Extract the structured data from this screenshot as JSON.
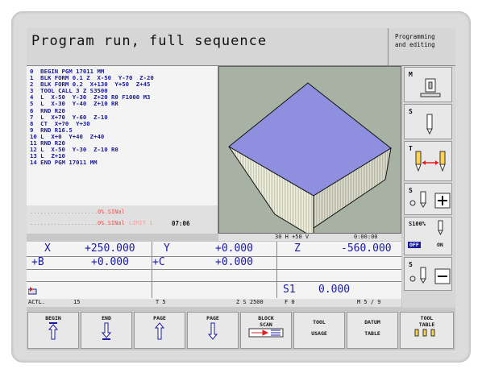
{
  "header": {
    "title": "Program run, full sequence",
    "mode_line1": "Programming",
    "mode_line2": "and editing"
  },
  "program": {
    "lines": [
      "0  BEGIN PGM 17011 MM",
      "1  BLK FORM 0.1 Z  X-50  Y-70  Z-20",
      "2  BLK FORM 0.2  X+130  Y+50  Z+45",
      "3  TOOL CALL 3 Z S3500",
      "4  L  X-50  Y-30  Z+20 R0 F1000 M3",
      "5  L  X-30  Y-40  Z+10 RR",
      "6  RND R20",
      "7  L  X+70  Y-60  Z-10",
      "8  CT  X+70  Y+30",
      "9  RND R16.5",
      "10 L  X+0  Y+40  Z+40",
      "11 RND R20",
      "12 L  X-50  Y-30  Z-10 R0",
      "13 L  Z+10",
      "14 END PGM 17011 MM"
    ]
  },
  "status": {
    "line1": "0% SINal",
    "line2": "0% SINal",
    "limit": "LIMIT 1",
    "time": "07:06"
  },
  "graphics": {
    "status_left": "30 H +50 V",
    "status_time": "0:00:00"
  },
  "sidebar": {
    "m_label": "M",
    "s_label": "S",
    "t_label": "T",
    "s2_label": "S",
    "s_pct": "S100%",
    "off": "OFF",
    "on": "ON",
    "s3_label": "S"
  },
  "positions": {
    "x_label": "X",
    "x_value": "+250.000",
    "y_label": "Y",
    "y_value": "+0.000",
    "z_label": "Z",
    "z_value": "-560.000",
    "b_label": "+B",
    "b_value": "+0.000",
    "c_label": "+C",
    "c_value": "+0.000",
    "s1_label": "S1",
    "s1_value": "0.000"
  },
  "bottom_status": {
    "actl": "ACTL.",
    "feed": "15",
    "t": "T 5",
    "zs": "Z S 2500",
    "f": "F 0",
    "m": "M 5 / 9"
  },
  "softkeys": {
    "begin": "BEGIN",
    "end": "END",
    "page_up": "PAGE",
    "page_down": "PAGE",
    "block1": "BLOCK",
    "block2": "SCAN",
    "tool1": "TOOL",
    "tool2": "USAGE",
    "datum1": "DATUM",
    "datum2": "TABLE",
    "tooltab1": "TOOL",
    "tooltab2": "TABLE"
  },
  "colors": {
    "accent": "#1a1aa0",
    "block_top": "#8f8fe0",
    "warning": "#ff4d4d"
  }
}
